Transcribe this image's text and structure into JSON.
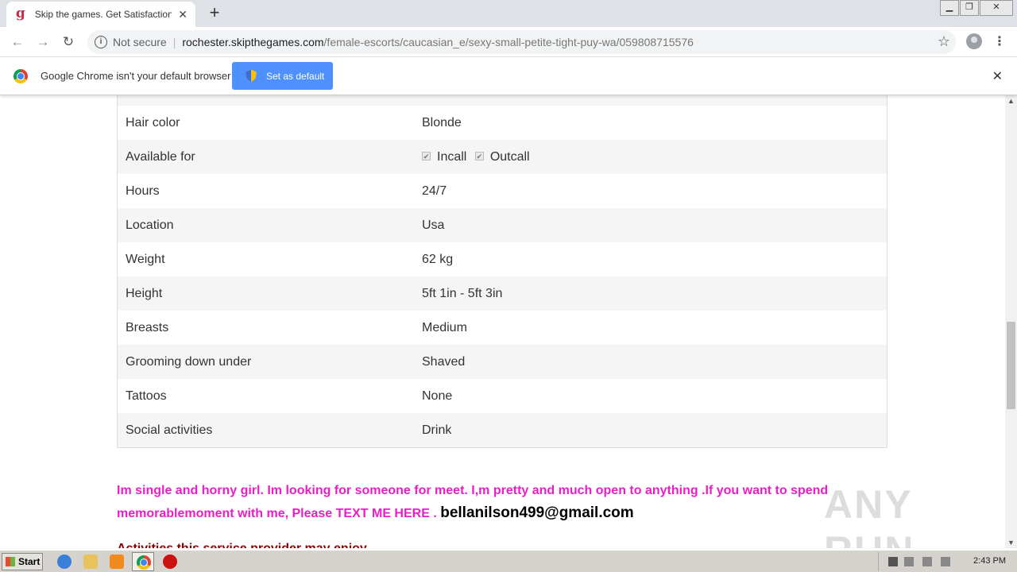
{
  "browser": {
    "tab_title": "Skip the games. Get Satisfaction. Me",
    "favicon_letter": "g",
    "url_security": "Not secure",
    "url_host": "rochester.skipthegames.com",
    "url_path": "/female-escorts/caucasian_e/sexy-small-petite-tight-puy-wa/059808715576"
  },
  "infobar": {
    "message": "Google Chrome isn't your default browser",
    "button_label": "Set as default"
  },
  "profile_table": [
    {
      "label": "Hair color",
      "value": "Blonde"
    },
    {
      "label": "Available for",
      "options": [
        {
          "label": "Incall",
          "checked": true
        },
        {
          "label": "Outcall",
          "checked": true
        }
      ]
    },
    {
      "label": "Hours",
      "value": "24/7"
    },
    {
      "label": "Location",
      "value": "Usa"
    },
    {
      "label": "Weight",
      "value": "62 kg"
    },
    {
      "label": "Height",
      "value": "5ft 1in - 5ft 3in"
    },
    {
      "label": "Breasts",
      "value": "Medium"
    },
    {
      "label": "Grooming down under",
      "value": "Shaved"
    },
    {
      "label": "Tattoos",
      "value": "None"
    },
    {
      "label": "Social activities",
      "value": "Drink"
    }
  ],
  "ad": {
    "text": "Im single and horny girl. Im looking for someone for meet. I,m pretty and much open to anything .If you want to spend memorablemoment with me, Please TEXT ME HERE .",
    "email": "bellanilson499@gmail.com",
    "activities_heading": "Activities this service provider may enjoy"
  },
  "watermark": "ANY RUN",
  "taskbar": {
    "start_label": "Start",
    "clock": "2:43 PM"
  },
  "colors": {
    "ad_text": "#e91ec8",
    "activities": "#8b0000",
    "infobar_button": "#4d90fe"
  }
}
